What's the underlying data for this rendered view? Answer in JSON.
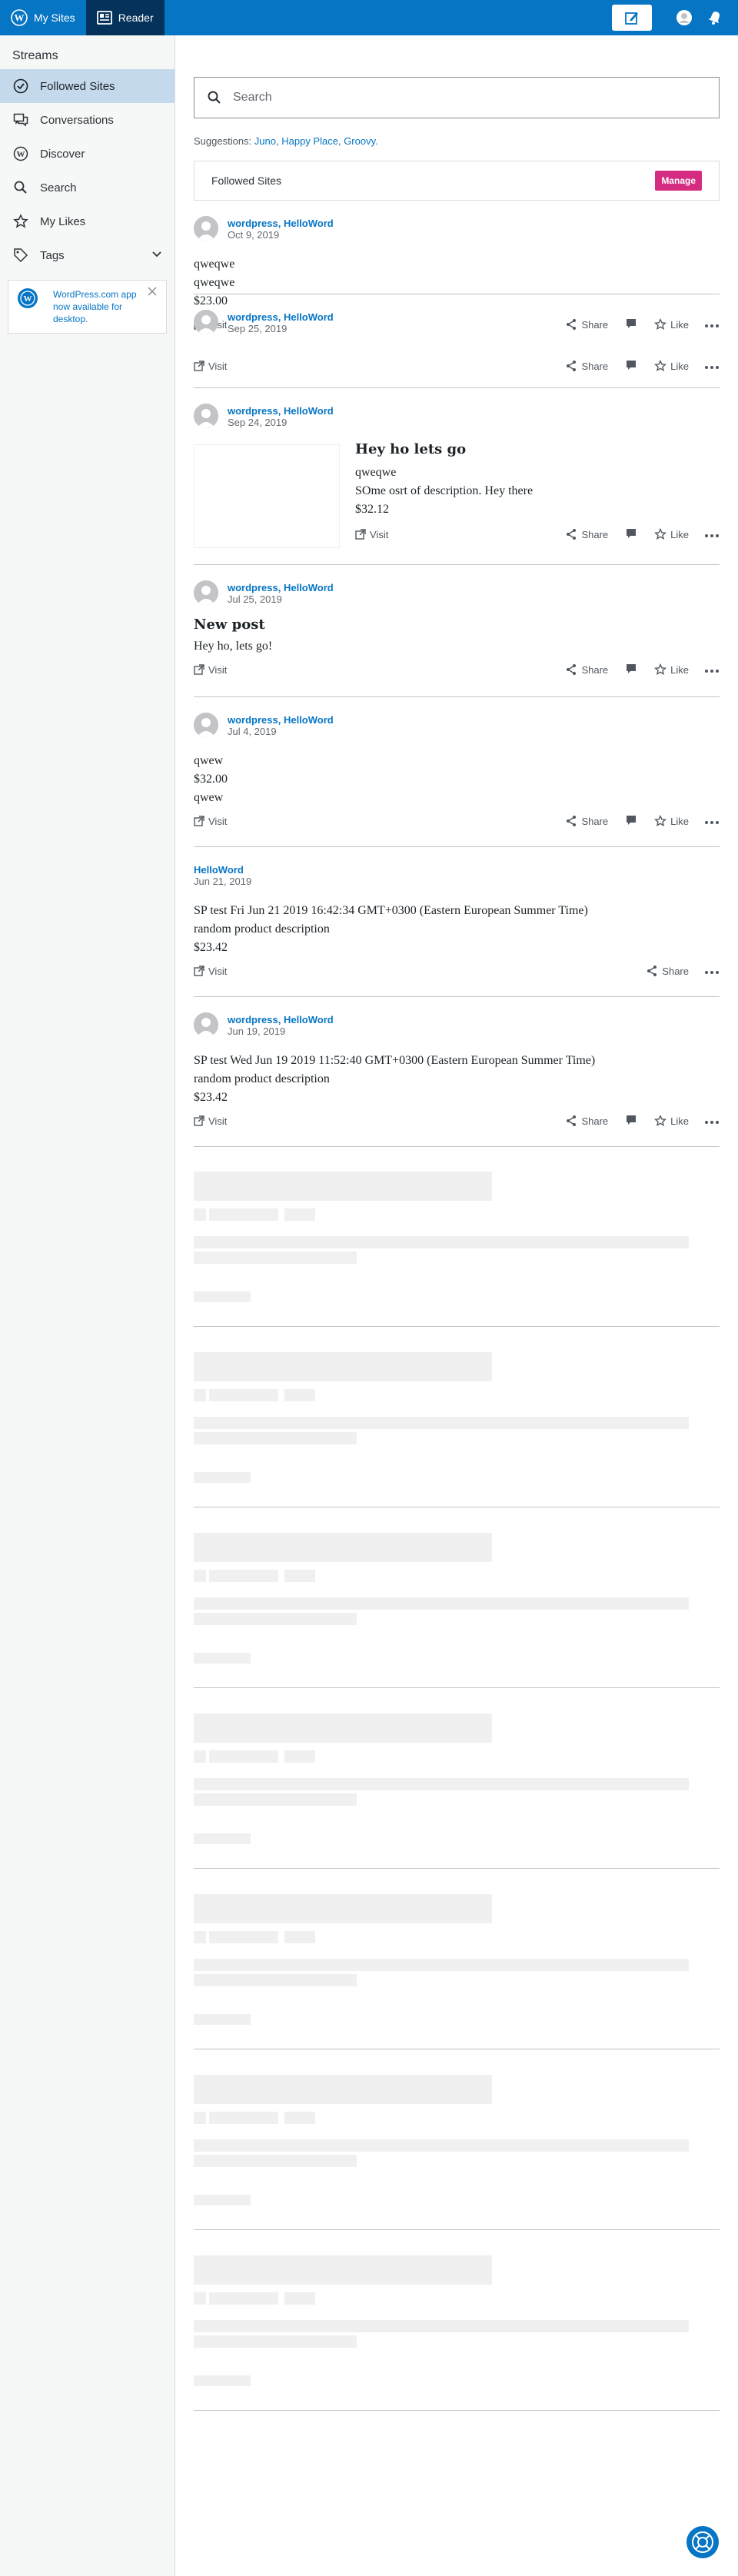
{
  "masterbar": {
    "my_sites": "My Sites",
    "reader": "Reader"
  },
  "sidebar": {
    "heading": "Streams",
    "items": [
      {
        "label": "Followed Sites",
        "icon": "checkmark-circle-icon"
      },
      {
        "label": "Conversations",
        "icon": "chat-bubbles-icon"
      },
      {
        "label": "Discover",
        "icon": "wordpress-icon"
      },
      {
        "label": "Search",
        "icon": "search-icon"
      },
      {
        "label": "My Likes",
        "icon": "star-icon"
      },
      {
        "label": "Tags",
        "icon": "tag-icon"
      }
    ],
    "app_notice": "WordPress.com app now available for desktop."
  },
  "search": {
    "placeholder": "Search"
  },
  "suggestions": {
    "label": "Suggestions:",
    "items": [
      "Juno",
      "Happy Place",
      "Groovy."
    ]
  },
  "followed": {
    "title": "Followed Sites",
    "manage": "Manage"
  },
  "actions": {
    "visit": "Visit",
    "share": "Share",
    "like": "Like"
  },
  "posts": [
    {
      "site": "wordpress, HelloWord",
      "date": "Oct 9, 2019",
      "lines": [
        "qweqwe",
        "qweqwe",
        "$23.00"
      ]
    },
    {
      "site": "wordpress, HelloWord",
      "date": "Sep 25, 2019",
      "lines": []
    },
    {
      "site": "wordpress, HelloWord",
      "date": "Sep 24, 2019",
      "title": "Hey ho lets go",
      "lines": [
        "qweqwe",
        "SOme osrt of description. Hey there",
        "$32.12"
      ]
    },
    {
      "site": "wordpress, HelloWord",
      "date": "Jul 25, 2019",
      "title": "New post",
      "lines": [
        "Hey ho, lets go!"
      ]
    },
    {
      "site": "wordpress, HelloWord",
      "date": "Jul 4, 2019",
      "lines": [
        "qwew",
        "$32.00",
        "qwew"
      ]
    },
    {
      "site": "HelloWord",
      "date": "Jun 21, 2019",
      "lines": [
        "SP test Fri Jun 21 2019 16:42:34 GMT+0300 (Eastern European Summer Time)",
        "random product description",
        "$23.42"
      ]
    },
    {
      "site": "wordpress, HelloWord",
      "date": "Jun 19, 2019",
      "lines": [
        "SP test Wed Jun 19 2019 11:52:40 GMT+0300 (Eastern European Summer Time)",
        "random product description",
        "$23.42"
      ]
    }
  ]
}
